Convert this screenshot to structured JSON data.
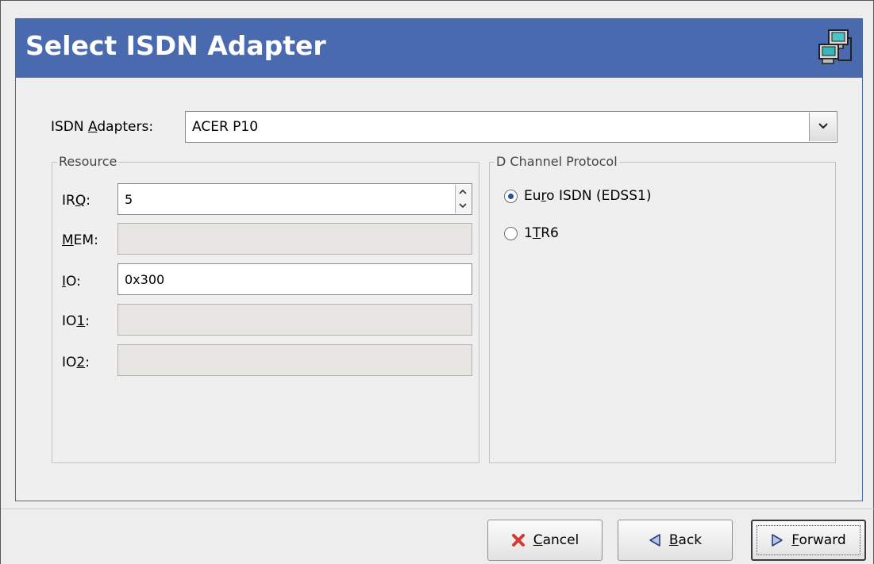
{
  "header": {
    "title": "Select ISDN Adapter",
    "icon": "network-computers-icon"
  },
  "adapter": {
    "label_pre": "ISDN ",
    "label_u": "A",
    "label_post": "dapters:",
    "value": "ACER P10"
  },
  "resource": {
    "title": "Resource",
    "irq": {
      "pre": "IR",
      "u": "Q",
      "post": ":",
      "value": "5"
    },
    "mem": {
      "pre": "",
      "u": "M",
      "post": "EM:",
      "value": ""
    },
    "io": {
      "pre": "",
      "u": "I",
      "post": "O:",
      "value": "0x300"
    },
    "io1": {
      "pre": "IO",
      "u": "1",
      "post": ":",
      "value": ""
    },
    "io2": {
      "pre": "IO",
      "u": "2",
      "post": ":",
      "value": ""
    }
  },
  "protocol": {
    "title": "D Channel Protocol",
    "options": [
      {
        "pre": "Eu",
        "u": "r",
        "post": "o ISDN (EDSS1)",
        "checked": true
      },
      {
        "pre": "1",
        "u": "T",
        "post": "R6",
        "checked": false
      }
    ]
  },
  "buttons": {
    "cancel": {
      "u": "C",
      "post": "ancel"
    },
    "back": {
      "u": "B",
      "post": "ack"
    },
    "forward": {
      "u": "F",
      "post": "orward"
    }
  },
  "colors": {
    "banner": "#4a6aaf",
    "cancel_icon": "#d43a2f"
  }
}
